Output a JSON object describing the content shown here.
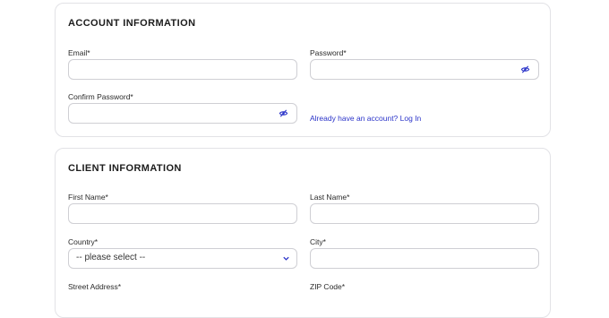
{
  "account": {
    "title": "ACCOUNT INFORMATION",
    "email_label": "Email*",
    "email_value": "",
    "password_label": "Password*",
    "password_value": "",
    "confirm_password_label": "Confirm Password*",
    "confirm_password_value": "",
    "login_link": "Already have an account? Log In"
  },
  "client": {
    "title": "CLIENT INFORMATION",
    "first_name_label": "First Name*",
    "first_name_value": "",
    "last_name_label": "Last Name*",
    "last_name_value": "",
    "country_label": "Country*",
    "country_selected": "-- please select --",
    "city_label": "City*",
    "city_value": "",
    "street_address_label": "Street Address*",
    "zip_code_label": "ZIP Code*"
  },
  "colors": {
    "accent": "#2b34c9",
    "border": "#cfcfd4",
    "card_border": "#e2e2e6"
  },
  "icons": {
    "password_toggle": "eye-slash-icon",
    "select_arrow": "chevron-down-icon"
  }
}
